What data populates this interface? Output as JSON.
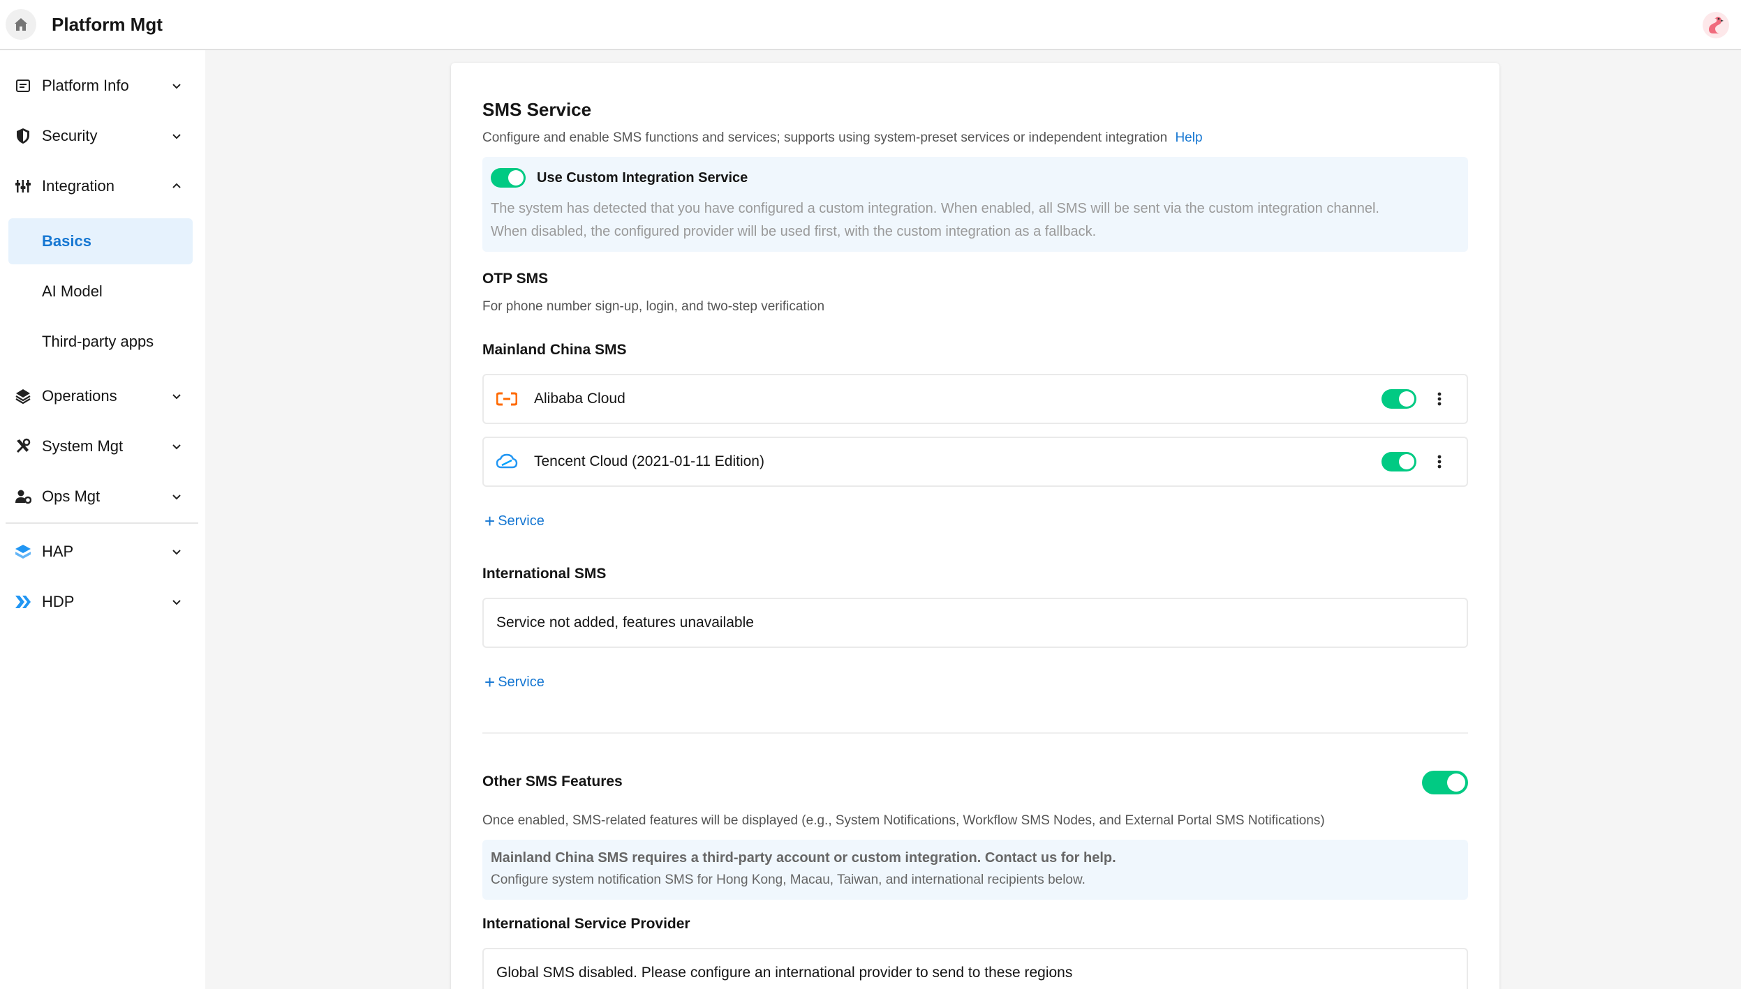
{
  "header": {
    "title": "Platform Mgt"
  },
  "sidebar": {
    "items": [
      {
        "label": "Platform Info",
        "icon": "info-card-icon"
      },
      {
        "label": "Security",
        "icon": "shield-icon"
      },
      {
        "label": "Integration",
        "icon": "integration-icon"
      },
      {
        "label": "Operations",
        "icon": "layers-icon"
      },
      {
        "label": "System Mgt",
        "icon": "tools-icon"
      },
      {
        "label": "Ops Mgt",
        "icon": "user-gear-icon"
      },
      {
        "label": "HAP",
        "icon": "hap-icon"
      },
      {
        "label": "HDP",
        "icon": "hdp-icon"
      }
    ],
    "integration_sub": [
      {
        "label": "Basics",
        "active": true
      },
      {
        "label": "AI Model"
      },
      {
        "label": "Third-party apps"
      }
    ]
  },
  "sms": {
    "title": "SMS Service",
    "description": "Configure and enable SMS functions and services; supports using system-preset services or independent integration",
    "help": "Help",
    "custom_integration": {
      "label": "Use Custom Integration Service",
      "enabled": true,
      "note_line1": "The system has detected that you have configured a custom integration. When enabled, all SMS will be sent via the custom integration channel.",
      "note_line2": "When disabled, the configured provider will be used first, with the custom integration as a fallback."
    },
    "otp": {
      "title": "OTP SMS",
      "description": "For phone number sign-up, login, and two-step verification"
    },
    "mainland": {
      "title": "Mainland China SMS",
      "providers": [
        {
          "name": "Alibaba Cloud",
          "icon": "alibaba-cloud-icon",
          "enabled": true
        },
        {
          "name": "Tencent Cloud (2021-01-11 Edition)",
          "icon": "tencent-cloud-icon",
          "enabled": true
        }
      ],
      "add_label": "Service"
    },
    "international": {
      "title": "International SMS",
      "empty": "Service not added, features unavailable",
      "add_label": "Service"
    },
    "other": {
      "title": "Other SMS Features",
      "enabled": true,
      "description": "Once enabled, SMS-related features will be displayed (e.g., System Notifications, Workflow SMS Nodes, and External Portal SMS Notifications)",
      "notice_bold": "Mainland China SMS requires a third-party account or custom integration. Contact us for help.",
      "notice_line": "Configure system notification SMS for Hong Kong, Macau, Taiwan, and international recipients below."
    },
    "intl_provider": {
      "title": "International Service Provider",
      "empty": "Global SMS disabled. Please configure an international provider to send to these regions"
    }
  },
  "colors": {
    "accent": "#1677d2",
    "toggle_on": "#01ca83",
    "active_bg": "#e6f2fd",
    "notice_bg": "#f0f7fd"
  }
}
